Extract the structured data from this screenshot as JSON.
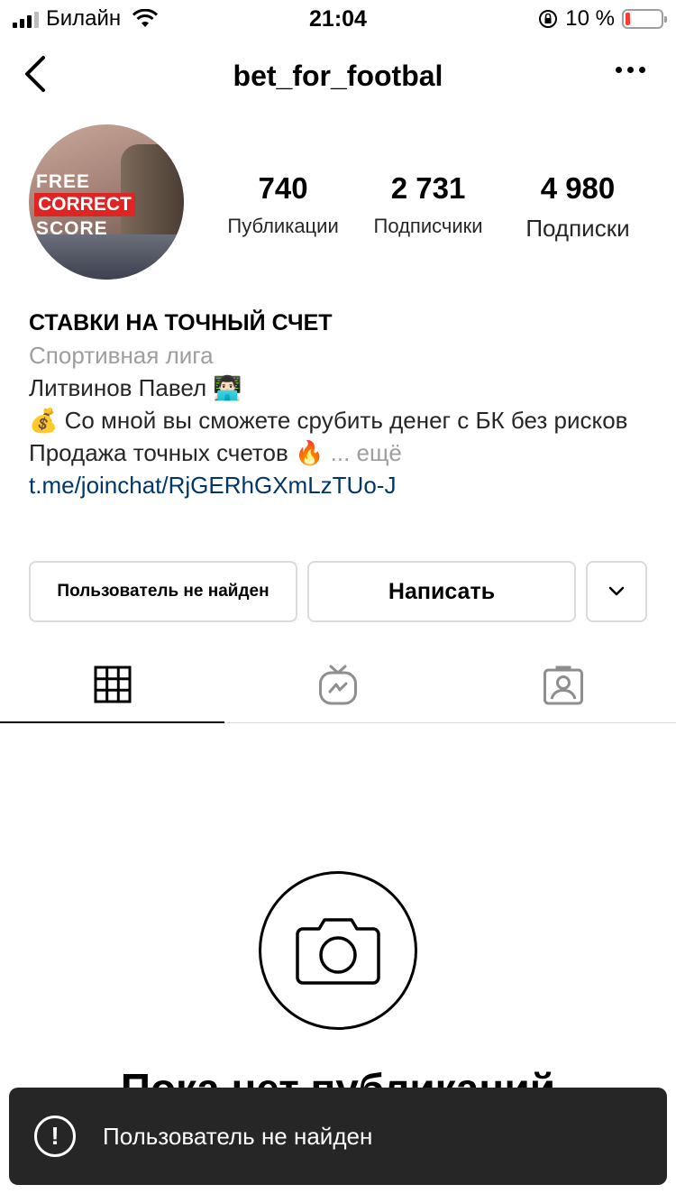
{
  "status_bar": {
    "carrier": "Билайн",
    "time": "21:04",
    "battery": "10 %",
    "battery_level": 0.1,
    "battery_color": "#ff3b30"
  },
  "nav": {
    "title": "bet_for_footbal",
    "back_icon": "chevron-left-icon",
    "more_icon": "more-horizontal-icon"
  },
  "avatar": {
    "line1": "FREE",
    "line2": "CORRECT",
    "line3": "SCORE"
  },
  "stats": [
    {
      "value": "740",
      "label": "Публикации"
    },
    {
      "value": "2 731",
      "label": "Подписчики"
    },
    {
      "value": "4 980",
      "label": "Подписки"
    }
  ],
  "bio": {
    "name": "СТАВКИ НА ТОЧНЫЙ СЧЕТ",
    "category": "Спортивная лига",
    "line1": "Литвинов Павел 👨🏻‍💻",
    "line2": "💰 Со мной вы сможете срубить денег с БК без рисков",
    "line3": "Продажа точных счетов 🔥",
    "more": "... ещё",
    "link": "t.me/joinchat/RjGERhGXmLzTUo-J",
    "link_color": "#00376b"
  },
  "buttons": {
    "not_found": "Пользователь не найден",
    "message": "Написать",
    "chevron_icon": "chevron-down-icon"
  },
  "tabs": [
    {
      "icon": "grid-icon",
      "active": true
    },
    {
      "icon": "igtv-icon",
      "active": false
    },
    {
      "icon": "tagged-person-icon",
      "active": false
    }
  ],
  "empty_state": {
    "title": "Пока нет публикаций",
    "icon": "camera-icon"
  },
  "toast": {
    "text": "Пользователь не найден",
    "icon": "exclamation-circle-icon"
  }
}
